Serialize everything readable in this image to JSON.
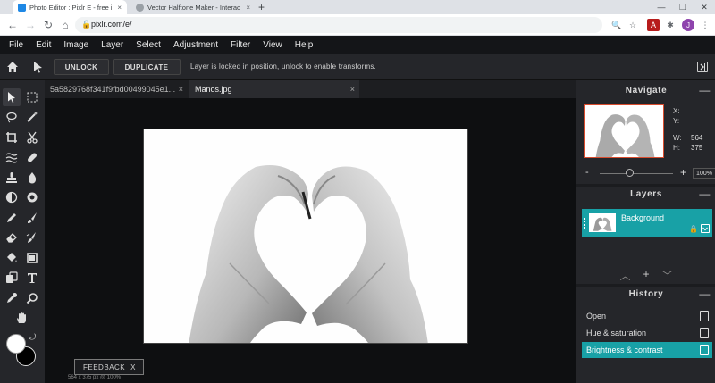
{
  "browser": {
    "tabs": [
      {
        "title": "Photo Editor : Pixlr E - free imag",
        "close": "×"
      },
      {
        "title": "Vector Halftone Maker - Interact",
        "close": "×"
      }
    ],
    "new_tab": "+",
    "url": "pixlr.com/e/",
    "avatar_letter": "J"
  },
  "menu": [
    "File",
    "Edit",
    "Image",
    "Layer",
    "Select",
    "Adjustment",
    "Filter",
    "View",
    "Help"
  ],
  "toolbar": {
    "unlock_label": "UNLOCK",
    "duplicate_label": "DUPLICATE",
    "hint": "Layer is locked in position, unlock to enable transforms."
  },
  "documents": {
    "tabs": [
      {
        "title": "5a5829768f341f9fbd00499045e1...",
        "close": "×"
      },
      {
        "title": "Manos.jpg",
        "close": "×"
      }
    ],
    "view_icon": "⧉▾"
  },
  "status": "564 x 375 px @ 100%",
  "feedback": {
    "label": "FEEDBACK",
    "close": "X"
  },
  "navigate": {
    "title": "Navigate",
    "minimize": "—",
    "x_label": "X:",
    "y_label": "Y:",
    "w_label": "W:",
    "h_label": "H:",
    "width": "564",
    "height": "375",
    "zoom_minus": "-",
    "zoom_plus": "+",
    "zoom": "100%",
    "zoom_level": 0.42
  },
  "layers": {
    "title": "Layers",
    "minimize": "—",
    "items": [
      {
        "name": "Background"
      }
    ],
    "actions": [
      "︿",
      "+",
      "﹀"
    ]
  },
  "history": {
    "title": "History",
    "minimize": "—",
    "items": [
      {
        "label": "Open"
      },
      {
        "label": "Hue & saturation"
      },
      {
        "label": "Brightness & contrast"
      }
    ]
  },
  "colors": {
    "accent": "#18a1a6",
    "foreground": "#ffffff",
    "background": "#000000"
  },
  "tools": [
    "arrange-icon",
    "marquee-icon",
    "lasso-icon",
    "magic-wand-icon",
    "crop-icon",
    "cut-icon",
    "liquify-icon",
    "heal-icon",
    "stamp-icon",
    "drop-icon",
    "dodge-icon",
    "sponge-icon",
    "pencil-icon",
    "brush-icon",
    "eraser-icon",
    "smudge-icon",
    "fill-icon",
    "shape-icon",
    "clone-icon",
    "text-icon",
    "eyedropper-icon",
    "zoom-icon",
    "hand-icon"
  ]
}
